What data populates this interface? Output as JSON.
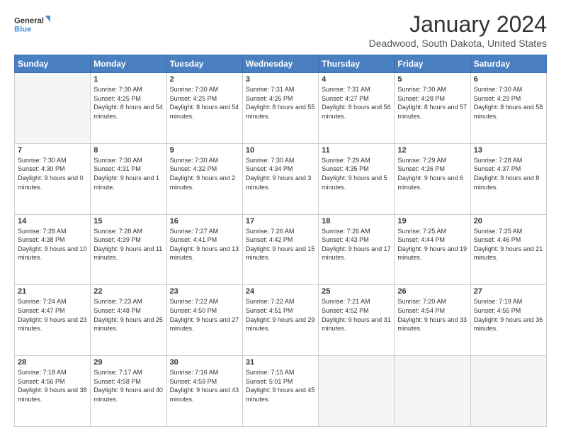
{
  "logo": {
    "line1": "General",
    "line2": "Blue"
  },
  "header": {
    "month": "January 2024",
    "location": "Deadwood, South Dakota, United States"
  },
  "days": [
    "Sunday",
    "Monday",
    "Tuesday",
    "Wednesday",
    "Thursday",
    "Friday",
    "Saturday"
  ],
  "weeks": [
    [
      {
        "num": "",
        "empty": true
      },
      {
        "num": "1",
        "sunrise": "7:30 AM",
        "sunset": "4:25 PM",
        "daylight": "8 hours and 54 minutes."
      },
      {
        "num": "2",
        "sunrise": "7:30 AM",
        "sunset": "4:25 PM",
        "daylight": "8 hours and 54 minutes."
      },
      {
        "num": "3",
        "sunrise": "7:31 AM",
        "sunset": "4:26 PM",
        "daylight": "8 hours and 55 minutes."
      },
      {
        "num": "4",
        "sunrise": "7:31 AM",
        "sunset": "4:27 PM",
        "daylight": "8 hours and 56 minutes."
      },
      {
        "num": "5",
        "sunrise": "7:30 AM",
        "sunset": "4:28 PM",
        "daylight": "8 hours and 57 minutes."
      },
      {
        "num": "6",
        "sunrise": "7:30 AM",
        "sunset": "4:29 PM",
        "daylight": "8 hours and 58 minutes."
      }
    ],
    [
      {
        "num": "7",
        "sunrise": "7:30 AM",
        "sunset": "4:30 PM",
        "daylight": "9 hours and 0 minutes."
      },
      {
        "num": "8",
        "sunrise": "7:30 AM",
        "sunset": "4:31 PM",
        "daylight": "9 hours and 1 minute."
      },
      {
        "num": "9",
        "sunrise": "7:30 AM",
        "sunset": "4:32 PM",
        "daylight": "9 hours and 2 minutes."
      },
      {
        "num": "10",
        "sunrise": "7:30 AM",
        "sunset": "4:34 PM",
        "daylight": "9 hours and 3 minutes."
      },
      {
        "num": "11",
        "sunrise": "7:29 AM",
        "sunset": "4:35 PM",
        "daylight": "9 hours and 5 minutes."
      },
      {
        "num": "12",
        "sunrise": "7:29 AM",
        "sunset": "4:36 PM",
        "daylight": "9 hours and 6 minutes."
      },
      {
        "num": "13",
        "sunrise": "7:28 AM",
        "sunset": "4:37 PM",
        "daylight": "9 hours and 8 minutes."
      }
    ],
    [
      {
        "num": "14",
        "sunrise": "7:28 AM",
        "sunset": "4:38 PM",
        "daylight": "9 hours and 10 minutes."
      },
      {
        "num": "15",
        "sunrise": "7:28 AM",
        "sunset": "4:39 PM",
        "daylight": "9 hours and 11 minutes."
      },
      {
        "num": "16",
        "sunrise": "7:27 AM",
        "sunset": "4:41 PM",
        "daylight": "9 hours and 13 minutes."
      },
      {
        "num": "17",
        "sunrise": "7:26 AM",
        "sunset": "4:42 PM",
        "daylight": "9 hours and 15 minutes."
      },
      {
        "num": "18",
        "sunrise": "7:26 AM",
        "sunset": "4:43 PM",
        "daylight": "9 hours and 17 minutes."
      },
      {
        "num": "19",
        "sunrise": "7:25 AM",
        "sunset": "4:44 PM",
        "daylight": "9 hours and 19 minutes."
      },
      {
        "num": "20",
        "sunrise": "7:25 AM",
        "sunset": "4:46 PM",
        "daylight": "9 hours and 21 minutes."
      }
    ],
    [
      {
        "num": "21",
        "sunrise": "7:24 AM",
        "sunset": "4:47 PM",
        "daylight": "9 hours and 23 minutes."
      },
      {
        "num": "22",
        "sunrise": "7:23 AM",
        "sunset": "4:48 PM",
        "daylight": "9 hours and 25 minutes."
      },
      {
        "num": "23",
        "sunrise": "7:22 AM",
        "sunset": "4:50 PM",
        "daylight": "9 hours and 27 minutes."
      },
      {
        "num": "24",
        "sunrise": "7:22 AM",
        "sunset": "4:51 PM",
        "daylight": "9 hours and 29 minutes."
      },
      {
        "num": "25",
        "sunrise": "7:21 AM",
        "sunset": "4:52 PM",
        "daylight": "9 hours and 31 minutes."
      },
      {
        "num": "26",
        "sunrise": "7:20 AM",
        "sunset": "4:54 PM",
        "daylight": "9 hours and 33 minutes."
      },
      {
        "num": "27",
        "sunrise": "7:19 AM",
        "sunset": "4:55 PM",
        "daylight": "9 hours and 36 minutes."
      }
    ],
    [
      {
        "num": "28",
        "sunrise": "7:18 AM",
        "sunset": "4:56 PM",
        "daylight": "9 hours and 38 minutes."
      },
      {
        "num": "29",
        "sunrise": "7:17 AM",
        "sunset": "4:58 PM",
        "daylight": "9 hours and 40 minutes."
      },
      {
        "num": "30",
        "sunrise": "7:16 AM",
        "sunset": "4:59 PM",
        "daylight": "9 hours and 43 minutes."
      },
      {
        "num": "31",
        "sunrise": "7:15 AM",
        "sunset": "5:01 PM",
        "daylight": "9 hours and 45 minutes."
      },
      {
        "num": "",
        "empty": true
      },
      {
        "num": "",
        "empty": true
      },
      {
        "num": "",
        "empty": true
      }
    ]
  ]
}
